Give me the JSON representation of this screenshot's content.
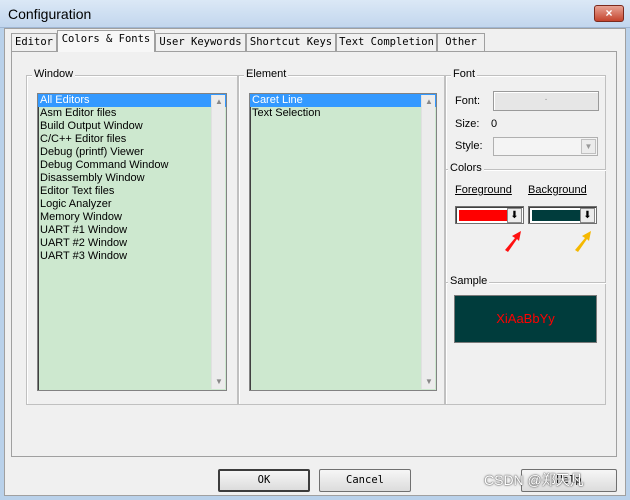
{
  "window": {
    "title": "Configuration",
    "close_glyph": "×"
  },
  "tabs": [
    {
      "label": "Editor"
    },
    {
      "label": "Colors & Fonts"
    },
    {
      "label": "User Keywords"
    },
    {
      "label": "Shortcut Keys"
    },
    {
      "label": "Text Completion"
    },
    {
      "label": "Other"
    }
  ],
  "window_group": {
    "label": "Window",
    "items": [
      "All Editors",
      "Asm Editor files",
      "Build Output Window",
      "C/C++ Editor files",
      "Debug (printf) Viewer",
      "Debug Command Window",
      "Disassembly Window",
      "Editor Text files",
      "Logic Analyzer",
      "Memory Window",
      "UART #1 Window",
      "UART #2 Window",
      "UART #3 Window"
    ],
    "selected": "All Editors"
  },
  "element_group": {
    "label": "Element",
    "items": [
      "Caret Line",
      "Text Selection"
    ],
    "selected": "Caret Line"
  },
  "font_group": {
    "label": "Font",
    "font_label": "Font:",
    "font_button": "·",
    "size_label": "Size:",
    "size_value": "0",
    "style_label": "Style:",
    "style_value": ""
  },
  "colors_group": {
    "label": "Colors",
    "foreground_label": "Foreground",
    "background_label": "Background",
    "foreground_color": "#ff0000",
    "background_color": "#003c3c",
    "dropdown_glyph": "⬇"
  },
  "annotations": {
    "arrow_foreground_color": "#ff1010",
    "arrow_background_color": "#f5b800"
  },
  "sample_group": {
    "label": "Sample",
    "text": "XiAaBbYy",
    "text_color": "#ff0000",
    "background_color": "#003c3c"
  },
  "buttons": {
    "ok": "OK",
    "cancel": "Cancel",
    "help": "Help"
  },
  "watermark": "CSDN @郑天凡",
  "colors": {
    "listbox_background": "#cde8cf",
    "selection": "#3399ff"
  }
}
